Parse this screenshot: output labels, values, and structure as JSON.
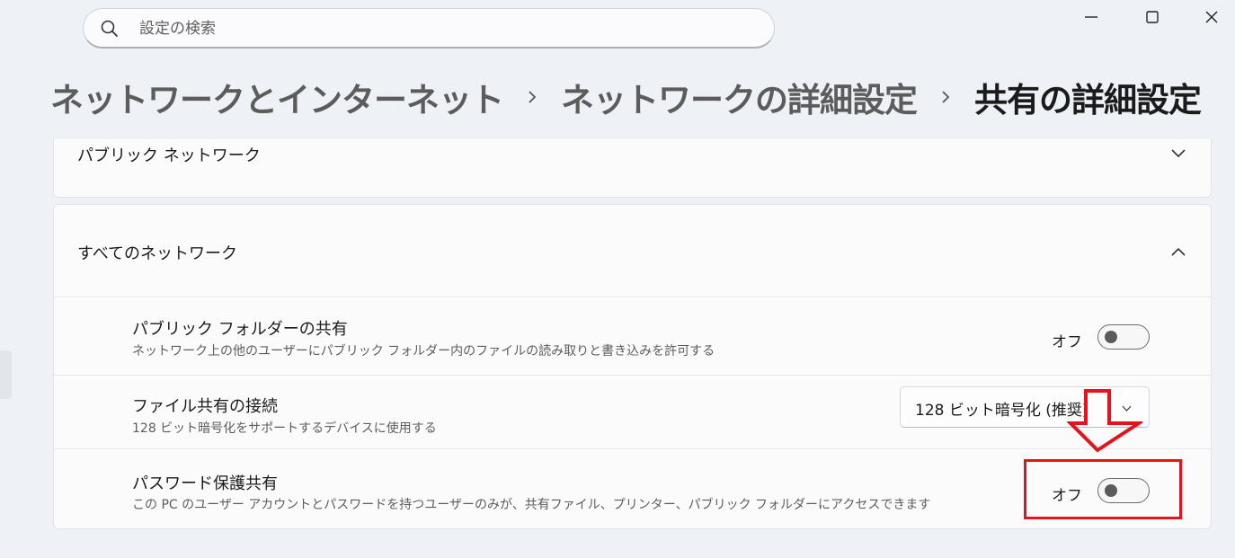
{
  "search": {
    "placeholder": "設定の検索",
    "icon": "search-icon"
  },
  "window_controls": {
    "minimize_icon": "minimize-icon",
    "maximize_icon": "maximize-icon",
    "close_icon": "close-icon"
  },
  "breadcrumb": {
    "items": [
      "ネットワークとインターネット",
      "ネットワークの詳細設定"
    ],
    "current": "共有の詳細設定",
    "separator_icon": "chevron-right-icon"
  },
  "sections": {
    "public_network": {
      "title": "パブリック ネットワーク",
      "expanded": false
    },
    "all_networks": {
      "title": "すべてのネットワーク",
      "expanded": true,
      "rows": [
        {
          "title": "パブリック フォルダーの共有",
          "description": "ネットワーク上の他のユーザーにパブリック フォルダー内のファイルの読み取りと書き込みを許可する",
          "state_label": "オフ",
          "on": false
        },
        {
          "title": "ファイル共有の接続",
          "description": "128 ビット暗号化をサポートするデバイスに使用する",
          "selected_value": "128 ビット暗号化 (推奨)"
        },
        {
          "title": "パスワード保護共有",
          "description": "この PC のユーザー アカウントとパスワードを持つユーザーのみが、共有ファイル、プリンター、パブリック フォルダーにアクセスできます",
          "state_label": "オフ",
          "on": false
        }
      ]
    }
  },
  "annotation": {
    "color": "#e5131d",
    "arrow_icon": "down-arrow-icon"
  },
  "colors": {
    "background": "#eef1f6",
    "card": "#fbfbfb",
    "annotation_red": "#e5131d"
  }
}
